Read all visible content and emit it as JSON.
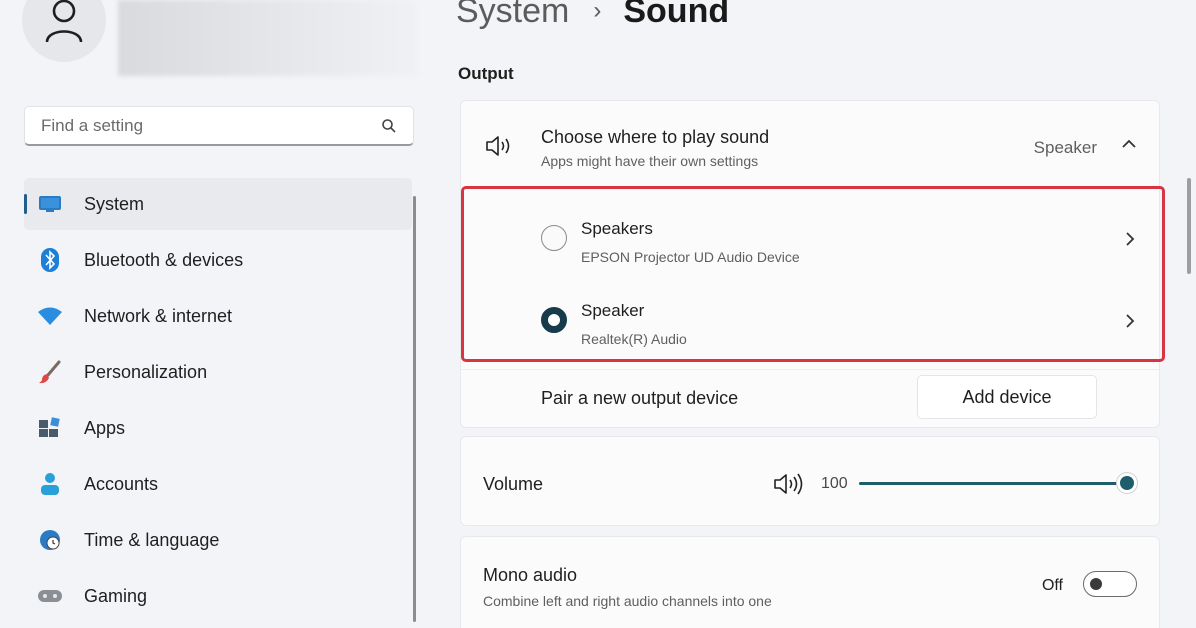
{
  "search": {
    "placeholder": "Find a setting"
  },
  "nav": {
    "items": [
      {
        "label": "System",
        "icon": "monitor-icon",
        "selected": true
      },
      {
        "label": "Bluetooth & devices",
        "icon": "bluetooth-icon"
      },
      {
        "label": "Network & internet",
        "icon": "wifi-icon"
      },
      {
        "label": "Personalization",
        "icon": "brush-icon"
      },
      {
        "label": "Apps",
        "icon": "apps-icon"
      },
      {
        "label": "Accounts",
        "icon": "person-icon"
      },
      {
        "label": "Time & language",
        "icon": "globe-clock-icon"
      },
      {
        "label": "Gaming",
        "icon": "gamepad-icon"
      }
    ]
  },
  "header": {
    "parent": "System",
    "separator": "›",
    "current": "Sound"
  },
  "output": {
    "section_label": "Output",
    "choose": {
      "title": "Choose where to play sound",
      "subtitle": "Apps might have their own settings",
      "value": "Speaker"
    },
    "devices": [
      {
        "name": "Speakers",
        "description": "EPSON Projector UD Audio Device",
        "selected": false
      },
      {
        "name": "Speaker",
        "description": "Realtek(R) Audio",
        "selected": true
      }
    ],
    "pair": {
      "label": "Pair a new output device",
      "button": "Add device"
    }
  },
  "volume": {
    "label": "Volume",
    "value": "100",
    "level": 1.0
  },
  "mono": {
    "title": "Mono audio",
    "subtitle": "Combine left and right audio channels into one",
    "state": "Off"
  },
  "colors": {
    "accent": "#1e5d6b",
    "highlight_border": "#d83442"
  }
}
